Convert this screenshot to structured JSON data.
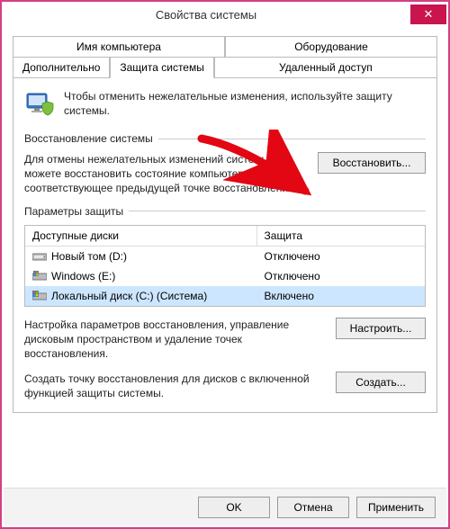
{
  "window": {
    "title": "Свойства системы",
    "close": "✕"
  },
  "tabs": {
    "computer_name": "Имя компьютера",
    "hardware": "Оборудование",
    "advanced": "Дополнительно",
    "system_protection": "Защита системы",
    "remote": "Удаленный доступ"
  },
  "info": {
    "text": "Чтобы отменить нежелательные изменения, используйте защиту системы."
  },
  "restore": {
    "group_label": "Восстановление системы",
    "text": "Для отмены нежелательных изменений системы вы можете восстановить состояние компьютера, соответствующее предыдущей точке восстановления.",
    "button": "Восстановить..."
  },
  "protection": {
    "group_label": "Параметры защиты",
    "col_disks": "Доступные диски",
    "col_protection": "Защита",
    "rows": [
      {
        "name": "Новый том (D:)",
        "status": "Отключено",
        "icon": "hdd"
      },
      {
        "name": "Windows (E:)",
        "status": "Отключено",
        "icon": "win"
      },
      {
        "name": "Локальный диск (C:) (Система)",
        "status": "Включено",
        "icon": "hdd-sys"
      }
    ],
    "configure_text": "Настройка параметров восстановления, управление дисковым пространством и удаление точек восстановления.",
    "configure_button": "Настроить...",
    "create_text": "Создать точку восстановления для дисков с включенной функцией защиты системы.",
    "create_button": "Создать..."
  },
  "footer": {
    "ok": "OK",
    "cancel": "Отмена",
    "apply": "Применить"
  }
}
